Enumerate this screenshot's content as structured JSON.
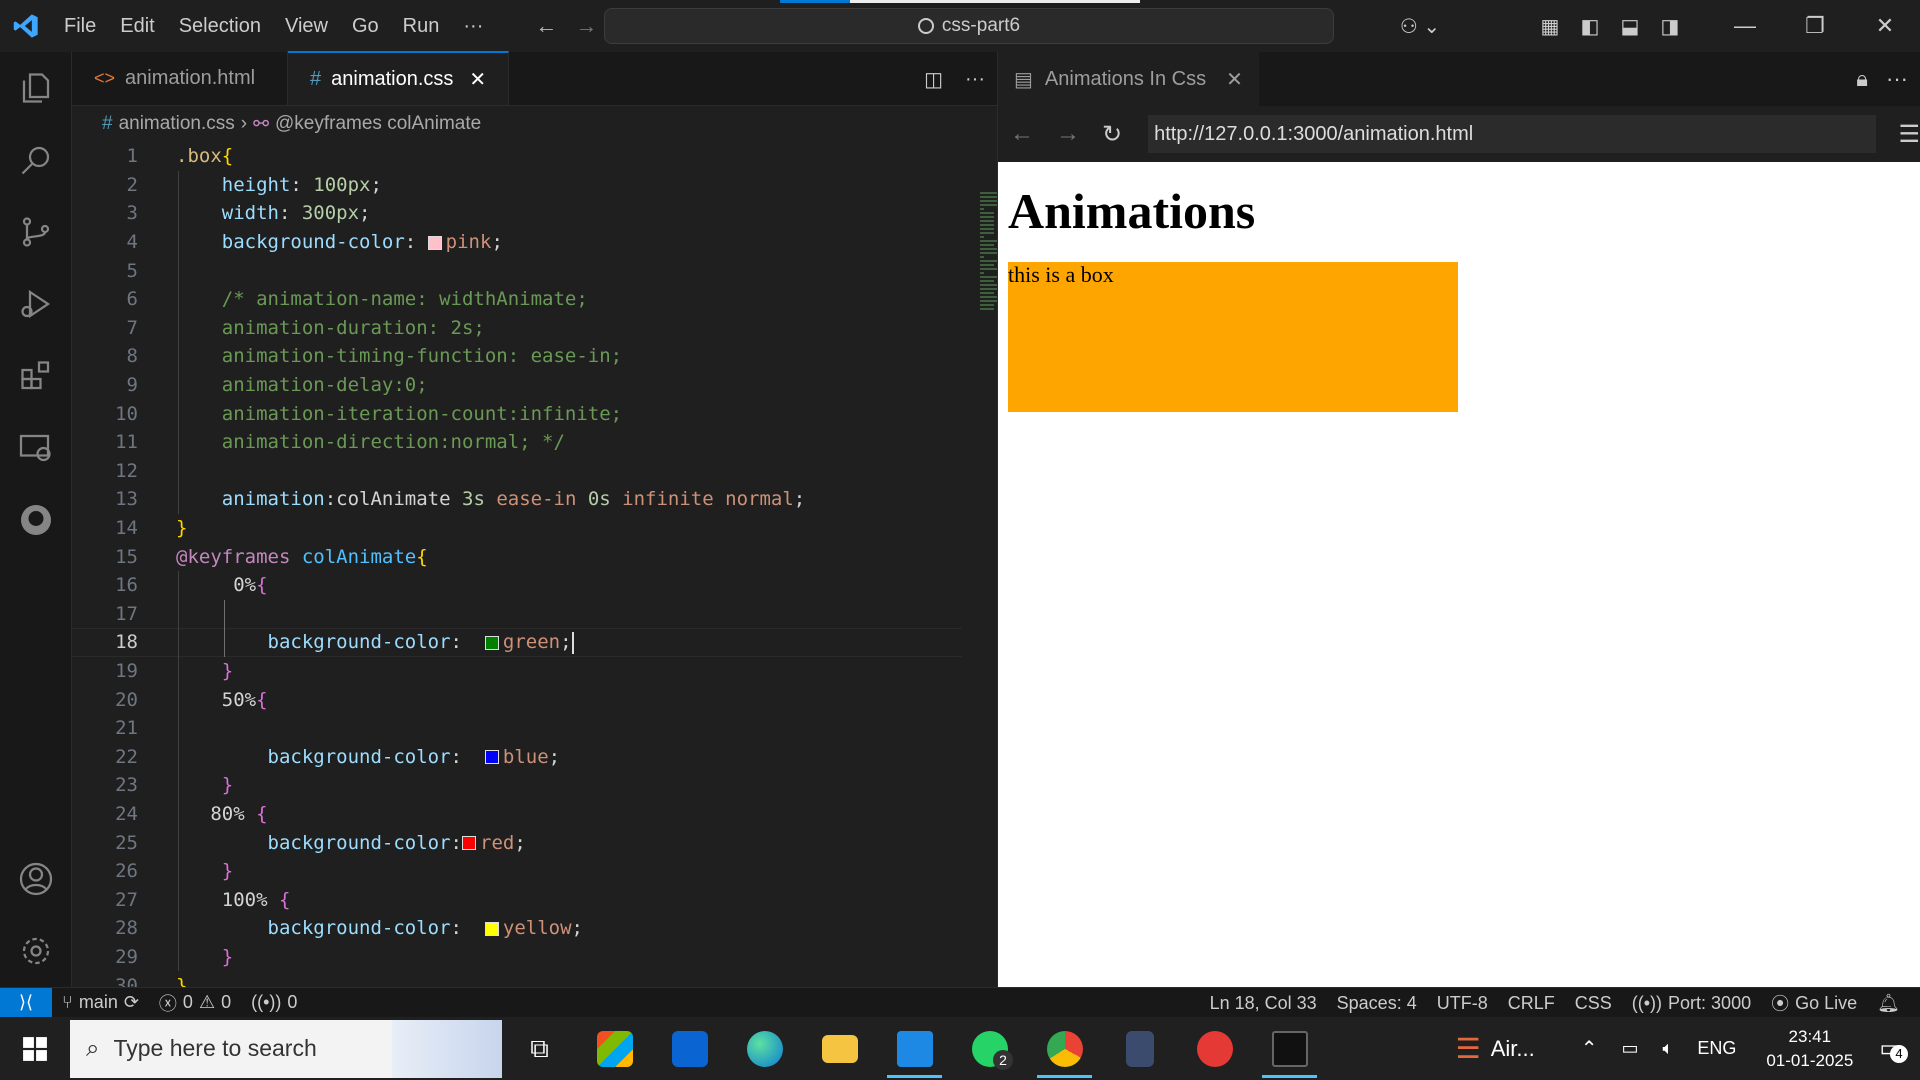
{
  "menu": [
    "File",
    "Edit",
    "Selection",
    "View",
    "Go",
    "Run",
    "···"
  ],
  "command_center": "css-part6",
  "editor": {
    "tabs": [
      {
        "icon": "html-icon",
        "label": "animation.html",
        "active": false
      },
      {
        "icon": "css-icon",
        "label": "animation.css",
        "active": true
      }
    ],
    "breadcrumb": {
      "file": "animation.css",
      "symbol": "@keyframes colAnimate"
    },
    "cursor_line": 18
  },
  "code_lines": [
    [
      [
        "sel",
        ".box"
      ],
      [
        "br",
        "{"
      ]
    ],
    [
      [
        "prop",
        "    height"
      ],
      [
        "pl",
        ": "
      ],
      [
        "num",
        "100px"
      ],
      [
        "pl",
        ";"
      ]
    ],
    [
      [
        "prop",
        "    width"
      ],
      [
        "pl",
        ": "
      ],
      [
        "num",
        "300px"
      ],
      [
        "pl",
        ";"
      ]
    ],
    [
      [
        "prop",
        "    background-color"
      ],
      [
        "pl",
        ": "
      ],
      [
        "sw",
        "#ffc0cb"
      ],
      [
        "val",
        "pink"
      ],
      [
        "pl",
        ";"
      ]
    ],
    [],
    [
      [
        "cmt",
        "    /* animation-name: widthAnimate;"
      ]
    ],
    [
      [
        "cmt",
        "    animation-duration: 2s;"
      ]
    ],
    [
      [
        "cmt",
        "    animation-timing-function: ease-in;"
      ]
    ],
    [
      [
        "cmt",
        "    animation-delay:0;"
      ]
    ],
    [
      [
        "cmt",
        "    animation-iteration-count:infinite;"
      ]
    ],
    [
      [
        "cmt",
        "    animation-direction:normal; */"
      ]
    ],
    [],
    [
      [
        "prop",
        "    animation"
      ],
      [
        "pl",
        ":colAnimate "
      ],
      [
        "num",
        "3s"
      ],
      [
        "val",
        " ease-in "
      ],
      [
        "num",
        "0s"
      ],
      [
        "val",
        " infinite normal"
      ],
      [
        "pl",
        ";"
      ]
    ],
    [
      [
        "br",
        "}"
      ]
    ],
    [
      [
        "at",
        "@keyframes"
      ],
      [
        "name",
        " colAnimate"
      ],
      [
        "br",
        "{"
      ]
    ],
    [
      [
        "pl",
        "     0%"
      ],
      [
        "br2",
        "{"
      ]
    ],
    [],
    [
      [
        "prop",
        "        background-color"
      ],
      [
        "pl",
        ":  "
      ],
      [
        "sw",
        "#008000"
      ],
      [
        "val",
        "green"
      ],
      [
        "pl",
        ";"
      ]
    ],
    [
      [
        "br2",
        "    }"
      ]
    ],
    [
      [
        "pl",
        "    50%"
      ],
      [
        "br2",
        "{"
      ]
    ],
    [],
    [
      [
        "prop",
        "        background-color"
      ],
      [
        "pl",
        ":  "
      ],
      [
        "sw",
        "#0000ff"
      ],
      [
        "val",
        "blue"
      ],
      [
        "pl",
        ";"
      ]
    ],
    [
      [
        "br2",
        "    }"
      ]
    ],
    [
      [
        "pl",
        "   80% "
      ],
      [
        "br2",
        "{"
      ]
    ],
    [
      [
        "prop",
        "        background-color"
      ],
      [
        "pl",
        ":"
      ],
      [
        "sw",
        "#ff0000"
      ],
      [
        "val",
        "red"
      ],
      [
        "pl",
        ";"
      ]
    ],
    [
      [
        "br2",
        "    }"
      ]
    ],
    [
      [
        "pl",
        "    100% "
      ],
      [
        "br2",
        "{"
      ]
    ],
    [
      [
        "prop",
        "        background-color"
      ],
      [
        "pl",
        ":  "
      ],
      [
        "sw",
        "#ffff00"
      ],
      [
        "val",
        "yellow"
      ],
      [
        "pl",
        ";"
      ]
    ],
    [
      [
        "br2",
        "    }"
      ]
    ],
    [
      [
        "br",
        "}"
      ]
    ]
  ],
  "browser": {
    "tab_title": "Animations In Css",
    "url": "http://127.0.0.1:3000/animation.html",
    "heading": "Animations",
    "box_text": "this is a box",
    "box_color": "#ffa500"
  },
  "status": {
    "branch": "main",
    "errors": "0",
    "warnings": "0",
    "ports": "0",
    "position": "Ln 18, Col 33",
    "spaces": "Spaces: 4",
    "encoding": "UTF-8",
    "eol": "CRLF",
    "language": "CSS",
    "port": "Port: 3000",
    "golive": "Go Live"
  },
  "taskbar": {
    "search_placeholder": "Type here to search",
    "whatsapp_badge": "2",
    "air_label": "Air...",
    "lang": "ENG",
    "time": "23:41",
    "date": "01-01-2025",
    "notifications": "4"
  },
  "colors": {
    "accent": "#0078d4",
    "editor_bg": "#1f1f1f"
  }
}
